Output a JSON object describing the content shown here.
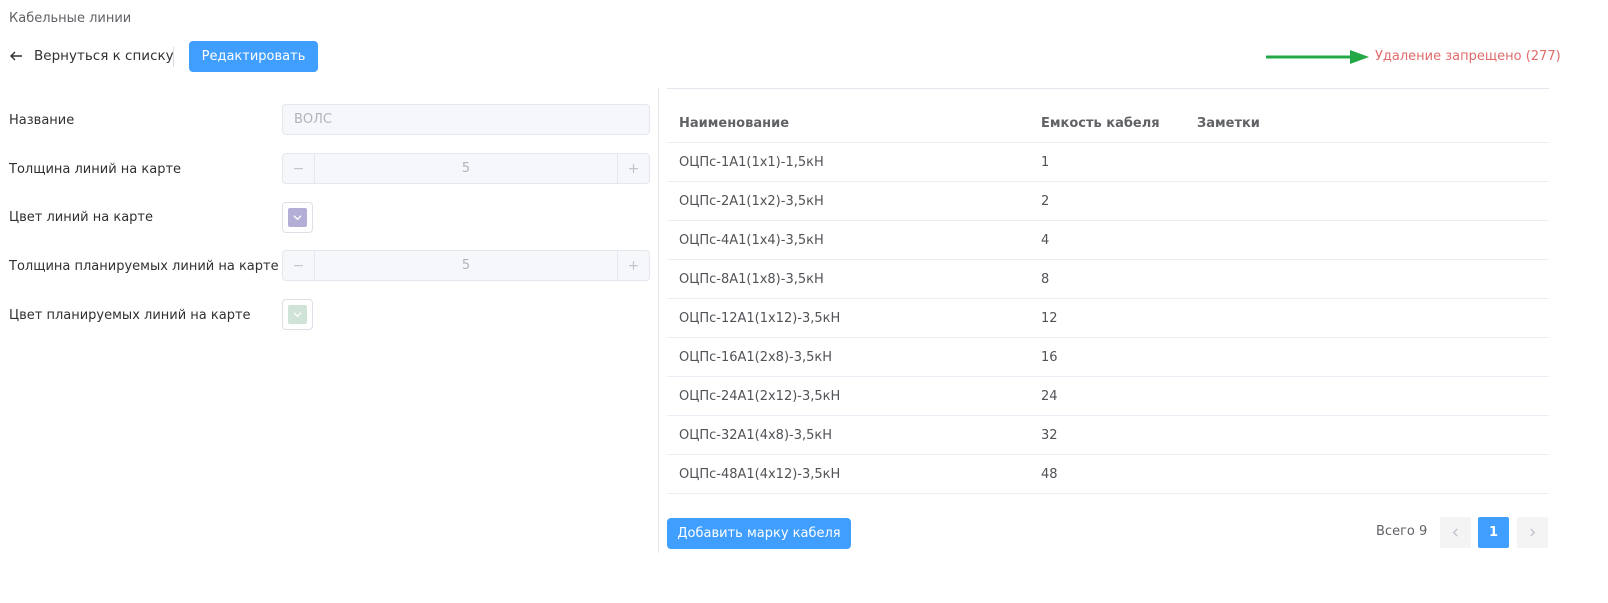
{
  "breadcrumb": "Кабельные линии",
  "header": {
    "back_label": "Вернуться к списку",
    "edit_label": "Редактировать",
    "delete_status": "Удаление запрещено (277)"
  },
  "form": {
    "name_label": "Название",
    "name_value": "ВОЛС",
    "line_width_label": "Толщина линий на карте",
    "line_width_value": "5",
    "line_color_label": "Цвет линий на карте",
    "line_color": "#b3aed5",
    "planned_width_label": "Толщина планируемых линий на карте",
    "planned_width_value": "5",
    "planned_color_label": "Цвет планируемых линий на карте",
    "planned_color": "#cfe3d6"
  },
  "table": {
    "headers": [
      "Наименование",
      "Емкость кабеля",
      "Заметки"
    ],
    "rows": [
      {
        "name": "ОЦПс-1А1(1х1)-1,5кН",
        "capacity": "1",
        "notes": ""
      },
      {
        "name": "ОЦПс-2А1(1х2)-3,5кН",
        "capacity": "2",
        "notes": ""
      },
      {
        "name": "ОЦПс-4А1(1х4)-3,5кН",
        "capacity": "4",
        "notes": ""
      },
      {
        "name": "ОЦПс-8А1(1х8)-3,5кН",
        "capacity": "8",
        "notes": ""
      },
      {
        "name": "ОЦПс-12А1(1х12)-3,5кН",
        "capacity": "12",
        "notes": ""
      },
      {
        "name": "ОЦПс-16А1(2х8)-3,5кН",
        "capacity": "16",
        "notes": ""
      },
      {
        "name": "ОЦПс-24А1(2х12)-3,5кН",
        "capacity": "24",
        "notes": ""
      },
      {
        "name": "ОЦПс-32А1(4х8)-3,5кН",
        "capacity": "32",
        "notes": ""
      },
      {
        "name": "ОЦПс-48А1(4х12)-3,5кН",
        "capacity": "48",
        "notes": ""
      }
    ]
  },
  "footer": {
    "add_label": "Добавить марку кабеля",
    "total_label": "Всего 9",
    "current_page": "1"
  },
  "colors": {
    "accent": "#409eff",
    "danger_text": "#e06c6c",
    "annotation_arrow": "#22a845"
  }
}
